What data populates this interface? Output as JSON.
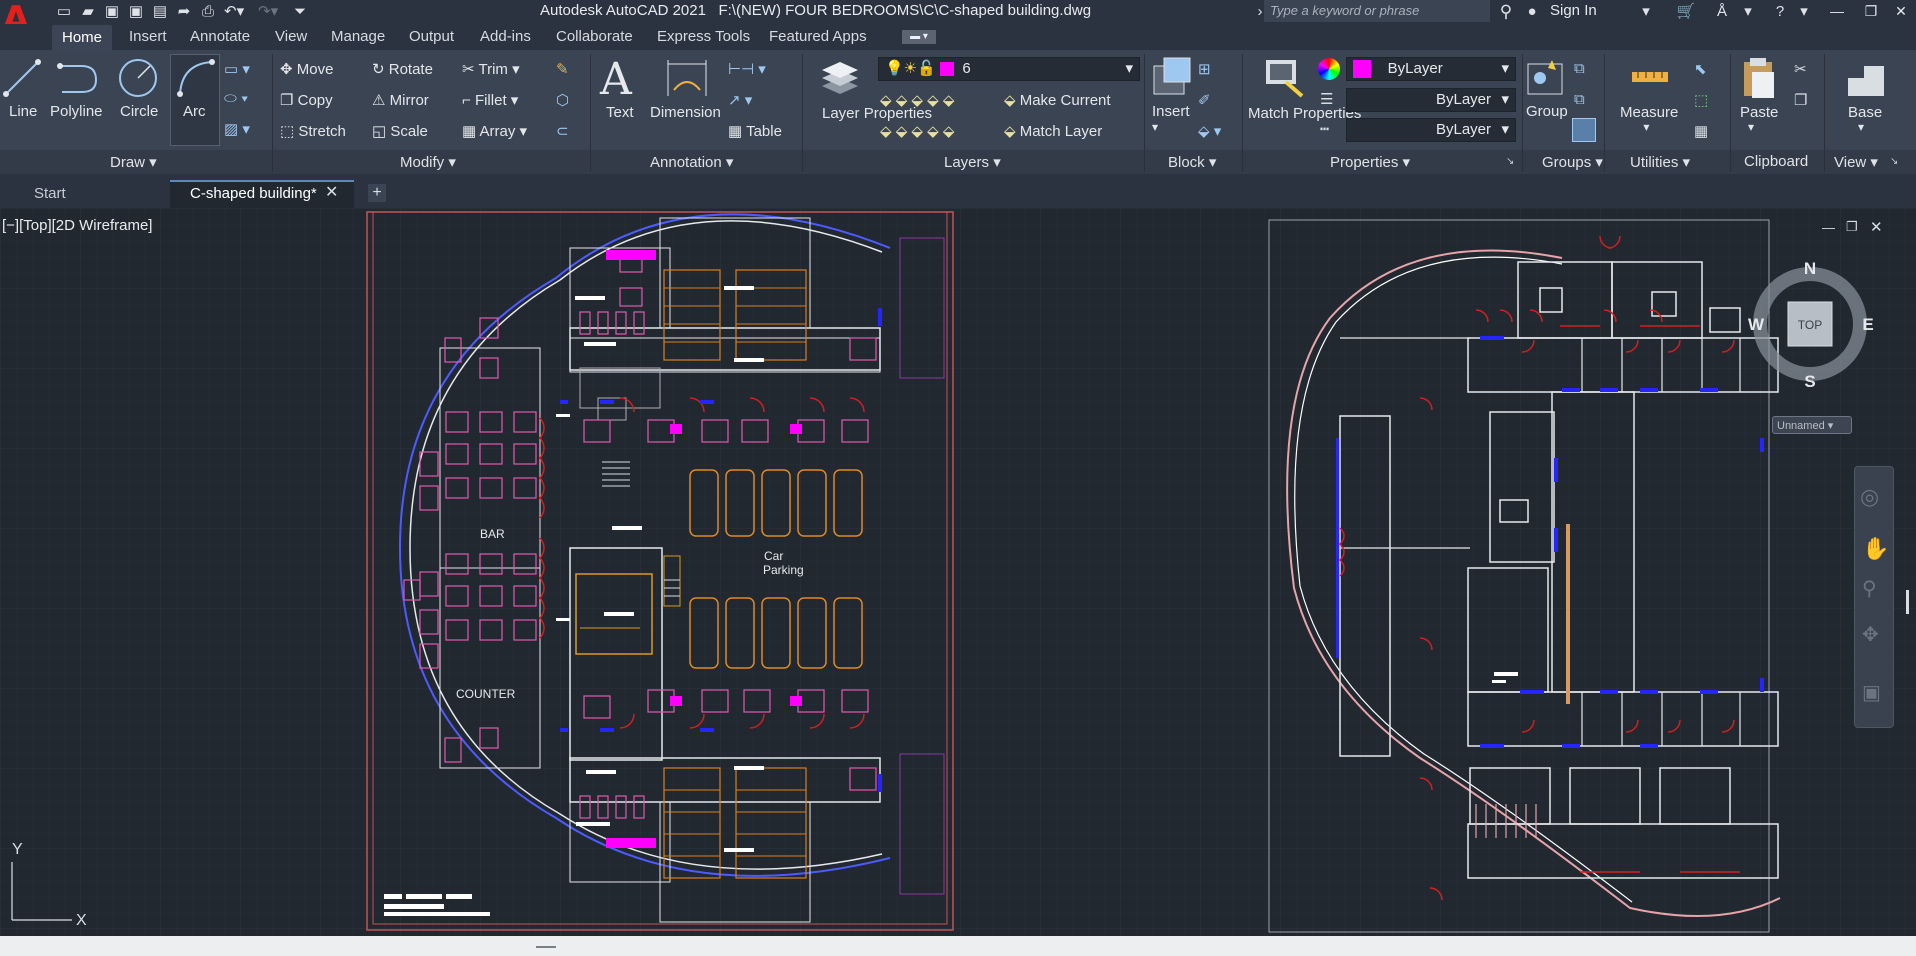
{
  "app": {
    "logo": "A",
    "title": "Autodesk AutoCAD 2021",
    "file_path": "F:\\(NEW) FOUR BEDROOMS\\C\\C-shaped building.dwg",
    "search_placeholder": "Type a keyword or phrase",
    "sign_in": "Sign In"
  },
  "ribbon_tabs": [
    "Home",
    "Insert",
    "Annotate",
    "View",
    "Manage",
    "Output",
    "Add-ins",
    "Collaborate",
    "Express Tools",
    "Featured Apps"
  ],
  "draw": {
    "title": "Draw",
    "line": "Line",
    "polyline": "Polyline",
    "circle": "Circle",
    "arc": "Arc"
  },
  "modify": {
    "title": "Modify",
    "move": "Move",
    "rotate": "Rotate",
    "trim": "Trim",
    "copy": "Copy",
    "mirror": "Mirror",
    "fillet": "Fillet",
    "stretch": "Stretch",
    "scale": "Scale",
    "array": "Array"
  },
  "annotation": {
    "title": "Annotation",
    "text": "Text",
    "dimension": "Dimension",
    "table": "Table"
  },
  "layers": {
    "title": "Layers",
    "layer_properties": "Layer Properties",
    "current_layer": "6",
    "make_current": "Make Current",
    "match_layer": "Match Layer"
  },
  "block": {
    "title": "Block",
    "insert": "Insert"
  },
  "properties": {
    "title": "Properties",
    "match": "Match Properties",
    "color": "ByLayer",
    "linetype": "ByLayer",
    "lineweight": "ByLayer"
  },
  "groups": {
    "title": "Groups",
    "group": "Group"
  },
  "utilities": {
    "title": "Utilities",
    "measure": "Measure"
  },
  "clipboard": {
    "title": "Clipboard",
    "paste": "Paste"
  },
  "viewpanel": {
    "title": "View",
    "base": "Base"
  },
  "doc_tabs": {
    "start": "Start",
    "active": "C-shaped building*"
  },
  "viewport": {
    "label": "[−][Top][2D Wireframe]",
    "plan_labels": {
      "bar": "BAR",
      "counter": "COUNTER",
      "car_parking_1": "Car",
      "car_parking_2": "Parking"
    },
    "viewcube": {
      "top": "TOP",
      "n": "N",
      "s": "S",
      "e": "E",
      "w": "W",
      "ucs": "Unnamed"
    },
    "ucs_y": "Y",
    "ucs_x": "X"
  },
  "colors": {
    "accent_magenta": "#ff00ff",
    "logo_red": "#e3201b",
    "ribbon_bg": "#3b4453",
    "canvas_bg": "#212830"
  }
}
